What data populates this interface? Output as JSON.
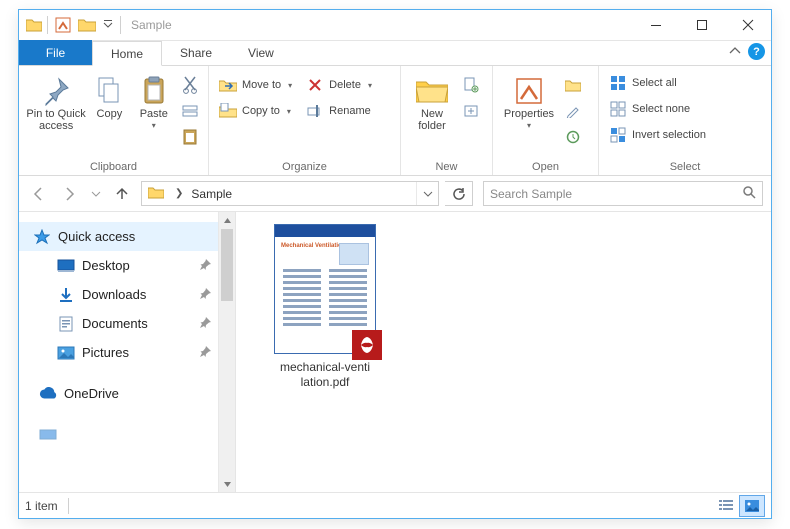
{
  "window": {
    "title": "Sample"
  },
  "tabs": {
    "file": "File",
    "home": "Home",
    "share": "Share",
    "view": "View"
  },
  "ribbon": {
    "clipboard": {
      "label": "Clipboard",
      "pin": "Pin to Quick access",
      "copy": "Copy",
      "paste": "Paste"
    },
    "organize": {
      "label": "Organize",
      "moveto": "Move to",
      "copyto": "Copy to",
      "delete": "Delete",
      "rename": "Rename"
    },
    "new": {
      "label": "New",
      "newfolder": "New folder"
    },
    "open": {
      "label": "Open",
      "properties": "Properties"
    },
    "select": {
      "label": "Select",
      "all": "Select all",
      "none": "Select none",
      "invert": "Invert selection"
    }
  },
  "breadcrumb": {
    "current": "Sample"
  },
  "search": {
    "placeholder": "Search Sample"
  },
  "tree": {
    "quick": "Quick access",
    "desktop": "Desktop",
    "downloads": "Downloads",
    "documents": "Documents",
    "pictures": "Pictures",
    "onedrive": "OneDrive"
  },
  "files": [
    {
      "name_line1": "mechanical-venti",
      "name_line2": "lation.pdf"
    }
  ],
  "status": {
    "count": "1 item"
  }
}
